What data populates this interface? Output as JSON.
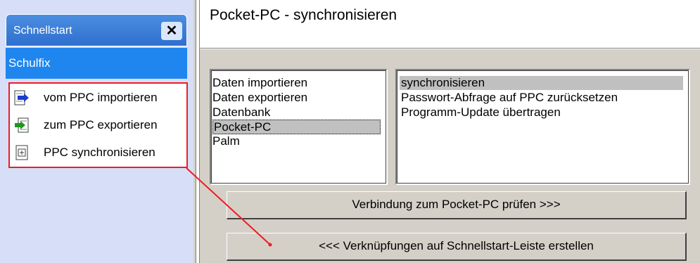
{
  "quickstart": {
    "title": "Schnellstart",
    "close_glyph": "✕",
    "group": "Schulfix",
    "items": [
      {
        "label": "vom PPC importieren",
        "icon": "import-arrow-icon"
      },
      {
        "label": "zum PPC exportieren",
        "icon": "export-arrow-icon"
      },
      {
        "label": "PPC synchronisieren",
        "icon": "sync-document-icon"
      }
    ]
  },
  "main": {
    "title": "Pocket-PC - synchronisieren",
    "categories": [
      "Daten importieren",
      "Daten exportieren",
      "Datenbank",
      "Pocket-PC",
      "Palm"
    ],
    "selected_category": "Pocket-PC",
    "actions": [
      "synchronisieren",
      "Passwort-Abfrage auf PPC zurücksetzen",
      "Programm-Update übertragen"
    ],
    "selected_action": "synchronisieren",
    "check_button": "Verbindung zum Pocket-PC prüfen >>>",
    "shortcuts_button": "<<< Verknüpfungen auf Schnellstart-Leiste erstellen"
  },
  "colors": {
    "annotation": "#ee1c25",
    "accent": "#1f86f0"
  }
}
